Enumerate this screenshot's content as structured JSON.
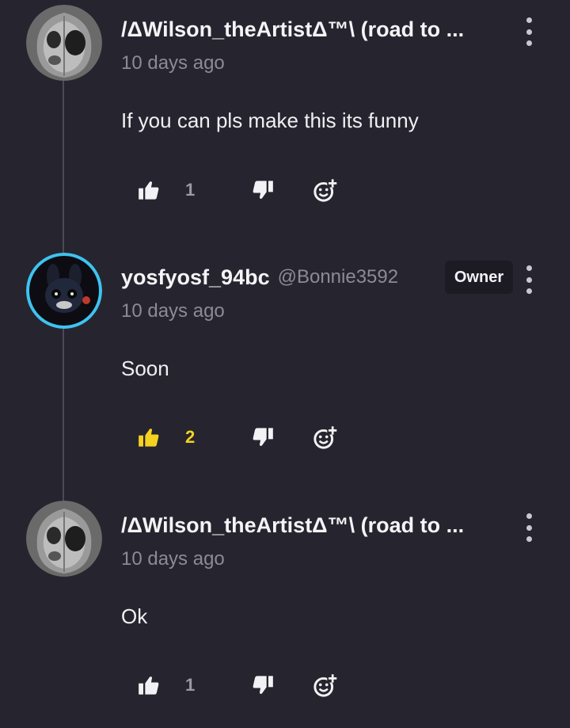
{
  "comments": [
    {
      "username": "/ΔWilson_theArtistΔ™\\ (road to ...",
      "handle": "",
      "badge": "",
      "time": "10 days ago",
      "text": "If you can pls make this its funny",
      "likes": "1",
      "liked": false,
      "avatar_icon": "gray-face-avatar"
    },
    {
      "username": "yosfyosf_94bc",
      "handle": "@Bonnie3592",
      "badge": "Owner",
      "time": "10 days ago",
      "text": "Soon",
      "likes": "2",
      "liked": true,
      "avatar_icon": "animatronic-avatar"
    },
    {
      "username": "/ΔWilson_theArtistΔ™\\ (road to ...",
      "handle": "",
      "badge": "",
      "time": "10 days ago",
      "text": "Ok",
      "likes": "1",
      "liked": false,
      "avatar_icon": "gray-face-avatar"
    }
  ],
  "colors": {
    "background": "#26252f",
    "liked": "#f5d21f",
    "icon": "#f2f2f5",
    "muted": "#8c8b95",
    "avatar_ring": "#3ec3f0"
  },
  "icons": {
    "like": "thumbs-up-icon",
    "dislike": "thumbs-down-icon",
    "reply": "add-reaction-icon",
    "menu": "more-vertical-icon"
  }
}
